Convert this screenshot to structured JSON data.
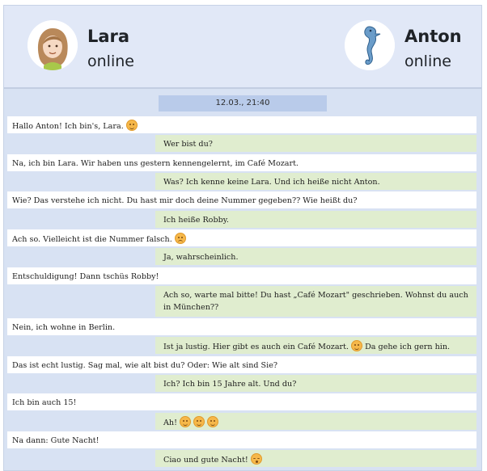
{
  "contacts": {
    "left": {
      "name": "Lara",
      "status": "online",
      "avatar_icon": "girl-avatar-icon"
    },
    "right": {
      "name": "Anton",
      "status": "online",
      "avatar_icon": "seahorse-avatar-icon"
    }
  },
  "chat": {
    "date": "12.03., 21:40",
    "messages": [
      {
        "side": "left",
        "text": "Hallo Anton! Ich bin's, Lara.",
        "emojis": [
          "smile"
        ]
      },
      {
        "side": "right",
        "text": "Wer bist du?"
      },
      {
        "side": "left",
        "text": "Na, ich bin Lara. Wir haben uns gestern kennengelernt, im Café Mozart."
      },
      {
        "side": "right",
        "text": "Was? Ich kenne keine Lara. Und ich heiße nicht Anton."
      },
      {
        "side": "left",
        "text": "Wie? Das verstehe ich nicht. Du hast mir doch deine Nummer gegeben?? Wie heißt du?"
      },
      {
        "side": "right",
        "text": "Ich heiße Robby."
      },
      {
        "side": "left",
        "text": "Ach so. Vielleicht ist die Nummer falsch.",
        "emojis": [
          "confused"
        ]
      },
      {
        "side": "right",
        "text": "Ja, wahrscheinlich."
      },
      {
        "side": "left",
        "text": "Entschuldigung! Dann tschüs Robby!"
      },
      {
        "side": "right",
        "text": "Ach so, warte mal bitte! Du hast „Café Mozart\" geschrieben. Wohnst du auch in München??"
      },
      {
        "side": "left",
        "text": "Nein, ich wohne in Berlin."
      },
      {
        "side": "right",
        "text": "Ist ja lustig. Hier gibt es auch ein Café Mozart.",
        "emojis": [
          "smile"
        ],
        "text_after": "Da gehe ich gern hin."
      },
      {
        "side": "left",
        "text": "Das ist echt lustig. Sag mal, wie alt bist du? Oder: Wie alt sind Sie?"
      },
      {
        "side": "right",
        "text": "Ich? Ich bin 15 Jahre alt. Und du?"
      },
      {
        "side": "left",
        "text": "Ich bin auch 15!"
      },
      {
        "side": "right",
        "text": "Ah!",
        "emojis": [
          "smile",
          "smile",
          "smile"
        ]
      },
      {
        "side": "left",
        "text": "Na dann: Gute Nacht!"
      },
      {
        "side": "right",
        "text": "Ciao und gute Nacht!",
        "emojis": [
          "sleepy"
        ]
      }
    ]
  }
}
